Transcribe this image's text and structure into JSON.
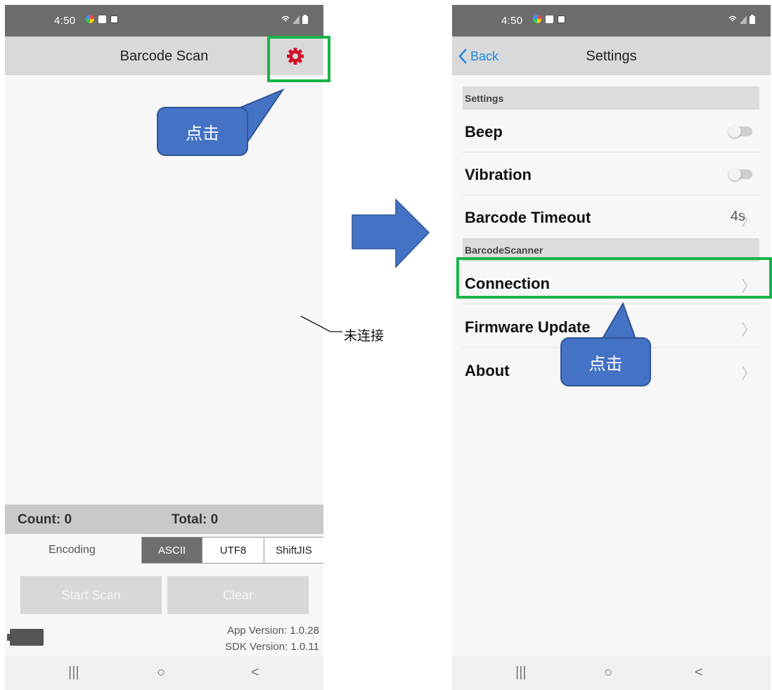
{
  "status_bar": {
    "time": "4:50"
  },
  "left_screen": {
    "title": "Barcode Scan",
    "count_label": "Count: 0",
    "total_label": "Total: 0",
    "encoding_label": "Encoding",
    "encoding_options": [
      "ASCII",
      "UTF8",
      "ShiftJIS"
    ],
    "encoding_selected": "ASCII",
    "start_scan_label": "Start Scan",
    "clear_label": "Clear",
    "app_version": "App Version: 1.0.28",
    "sdk_version": "SDK Version: 1.0.11"
  },
  "right_screen": {
    "back_label": "Back",
    "title": "Settings",
    "sections": [
      {
        "header": "Settings",
        "rows": [
          {
            "label": "Beep",
            "control": "toggle",
            "on": false
          },
          {
            "label": "Vibration",
            "control": "toggle",
            "on": false
          },
          {
            "label": "Barcode Timeout",
            "value": "4s",
            "control": "chevron"
          }
        ]
      },
      {
        "header": "BarcodeScanner",
        "rows": [
          {
            "label": "Connection",
            "control": "chevron"
          },
          {
            "label": "Firmware Update",
            "control": "chevron"
          },
          {
            "label": "About",
            "control": "chevron"
          }
        ]
      }
    ]
  },
  "system_nav": {
    "recents": "|||",
    "home": "○",
    "back": "<"
  },
  "annotations": {
    "callout_left": "点击",
    "callout_right": "点击",
    "disconnected_note": "未连接"
  },
  "colors": {
    "highlight_green": "#19b449",
    "callout_blue": "#4472c4",
    "gear_red": "#d0102a",
    "ios_blue": "#1e88e5"
  }
}
